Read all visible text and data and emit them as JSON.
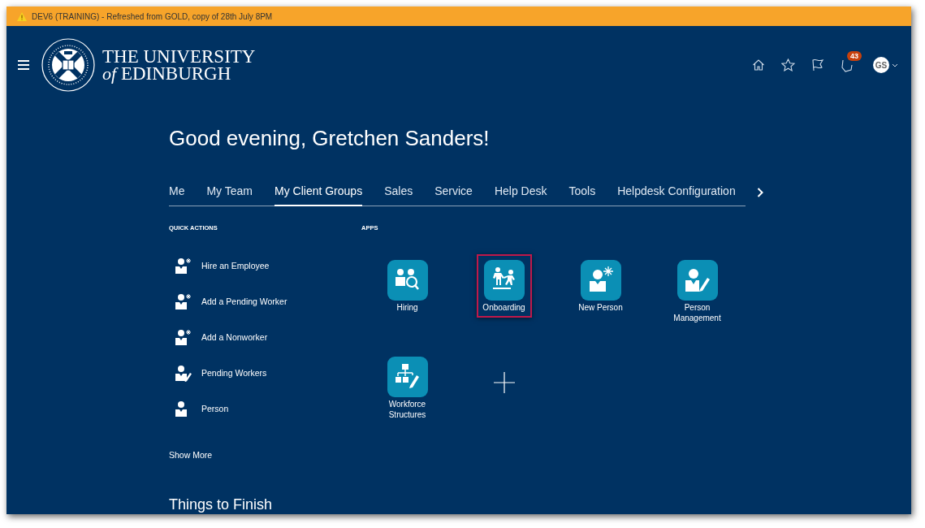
{
  "banner": {
    "text": "DEV6 (TRAINING) - Refreshed from GOLD, copy of 28th July 8PM"
  },
  "header": {
    "logo_line_1": "THE UNIVERSITY",
    "logo_line_2_italic": "of",
    "logo_line_2": "EDINBURGH",
    "notification_count": "43",
    "avatar_initials": "GS"
  },
  "greeting": "Good evening, Gretchen Sanders!",
  "tabs": [
    {
      "label": "Me",
      "selected": false
    },
    {
      "label": "My Team",
      "selected": false
    },
    {
      "label": "My Client Groups",
      "selected": true
    },
    {
      "label": "Sales",
      "selected": false
    },
    {
      "label": "Service",
      "selected": false
    },
    {
      "label": "Help Desk",
      "selected": false
    },
    {
      "label": "Tools",
      "selected": false
    },
    {
      "label": "Helpdesk Configuration",
      "selected": false
    }
  ],
  "quick_actions": {
    "title": "QUICK ACTIONS",
    "items": [
      {
        "label": "Hire an Employee",
        "kind": "new"
      },
      {
        "label": "Add a Pending Worker",
        "kind": "new"
      },
      {
        "label": "Add a Nonworker",
        "kind": "new"
      },
      {
        "label": "Pending Workers",
        "kind": "edit"
      },
      {
        "label": "Person",
        "kind": "view"
      }
    ],
    "show_more": "Show More"
  },
  "apps": {
    "title": "APPS",
    "items": [
      {
        "label": "Hiring",
        "kind": "hiring",
        "highlighted": false
      },
      {
        "label": "Onboarding",
        "kind": "onboarding",
        "highlighted": true
      },
      {
        "label": "New Person",
        "kind": "new-person",
        "highlighted": false
      },
      {
        "label": "Person Management",
        "kind": "person-management",
        "highlighted": false
      },
      {
        "label": "Workforce Structures",
        "kind": "workforce-structures",
        "highlighted": false
      },
      {
        "kind": "add"
      }
    ]
  },
  "things_to_finish": "Things to Finish"
}
